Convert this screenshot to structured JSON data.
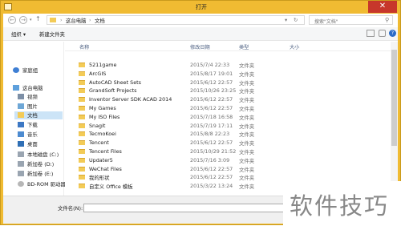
{
  "window": {
    "title": "打开"
  },
  "nav": {
    "back": "←",
    "forward": "→",
    "up": "↑",
    "path": [
      "这台电脑",
      "文档"
    ],
    "search_placeholder": "搜索\"文档\""
  },
  "toolbar": {
    "organize": "组织 ▾",
    "new_folder": "新建文件夹"
  },
  "sidebar": {
    "items": [
      {
        "label": "家庭组",
        "icon": "homegroup-icon"
      },
      {
        "label": "这台电脑",
        "icon": "computer-icon"
      },
      {
        "label": "视频",
        "icon": "video-folder-icon"
      },
      {
        "label": "图片",
        "icon": "pictures-folder-icon"
      },
      {
        "label": "文档",
        "icon": "documents-folder-icon"
      },
      {
        "label": "下载",
        "icon": "downloads-folder-icon"
      },
      {
        "label": "音乐",
        "icon": "music-folder-icon"
      },
      {
        "label": "桌面",
        "icon": "desktop-folder-icon"
      },
      {
        "label": "本地磁盘 (C:)",
        "icon": "drive-icon"
      },
      {
        "label": "新加卷 (D:)",
        "icon": "drive-icon"
      },
      {
        "label": "新加卷 (E:)",
        "icon": "drive-icon"
      },
      {
        "label": "BD-ROM 驱动器",
        "icon": "optical-drive-icon"
      }
    ]
  },
  "columns": {
    "name": "名称",
    "modified": "修改日期",
    "type": "类型",
    "size": "大小"
  },
  "files": [
    {
      "name": "5211game",
      "date": "2015/7/4 22:33",
      "type": "文件夹"
    },
    {
      "name": "ArcGIS",
      "date": "2015/8/17 19:01",
      "type": "文件夹"
    },
    {
      "name": "AutoCAD Sheet Sets",
      "date": "2015/6/12 22:57",
      "type": "文件夹"
    },
    {
      "name": "GrandSoft Projects",
      "date": "2015/10/26 23:25",
      "type": "文件夹"
    },
    {
      "name": "Inventor Server SDK ACAD 2014",
      "date": "2015/6/12 22:57",
      "type": "文件夹"
    },
    {
      "name": "My Games",
      "date": "2015/6/12 22:57",
      "type": "文件夹"
    },
    {
      "name": "My ISO Files",
      "date": "2015/7/18 16:58",
      "type": "文件夹"
    },
    {
      "name": "Snagit",
      "date": "2015/7/19 17:11",
      "type": "文件夹"
    },
    {
      "name": "TecmoKoei",
      "date": "2015/8/8 22:23",
      "type": "文件夹"
    },
    {
      "name": "Tencent",
      "date": "2015/6/12 22:57",
      "type": "文件夹"
    },
    {
      "name": "Tencent Files",
      "date": "2015/10/29 21:52",
      "type": "文件夹"
    },
    {
      "name": "Updater5",
      "date": "2015/7/16 3:09",
      "type": "文件夹"
    },
    {
      "name": "WeChat Files",
      "date": "2015/6/12 22:57",
      "type": "文件夹"
    },
    {
      "name": "我的形状",
      "date": "2015/6/12 22:57",
      "type": "文件夹"
    },
    {
      "name": "自定义 Office 模板",
      "date": "2015/3/22 13:24",
      "type": "文件夹"
    }
  ],
  "footer": {
    "filename_label": "文件名(N):"
  },
  "watermark": "软件技巧",
  "colors": {
    "frame": "#f0bb32",
    "close": "#c7372b",
    "folder": "#f3cb57"
  }
}
